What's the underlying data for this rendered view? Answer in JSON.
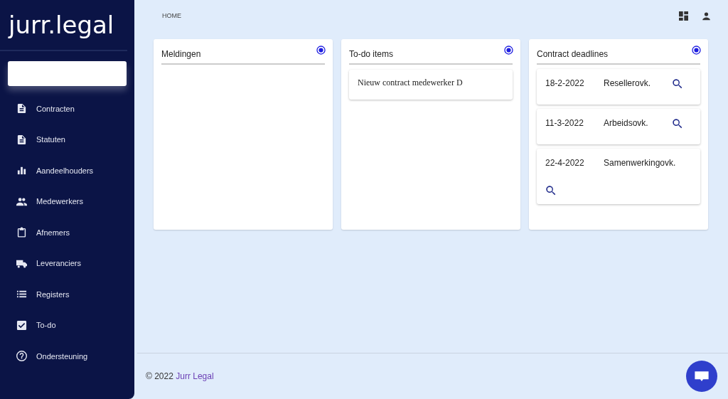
{
  "sidebar": {
    "logo": "jurr.legal",
    "items": [
      {
        "label": "Contracten"
      },
      {
        "label": "Statuten"
      },
      {
        "label": "Aandeelhouders"
      },
      {
        "label": "Medewerkers"
      },
      {
        "label": "Afnemers"
      },
      {
        "label": "Leveranciers"
      },
      {
        "label": "Registers"
      },
      {
        "label": "To-do"
      },
      {
        "label": "Ondersteuning"
      }
    ]
  },
  "breadcrumb": "HOME",
  "cards": [
    {
      "title": "Meldingen",
      "radio_checked": true,
      "kind": "empty"
    },
    {
      "title": "To-do items",
      "radio_checked": true,
      "kind": "todo",
      "items": [
        "Nieuw contract medewerker D"
      ]
    },
    {
      "title": "Contract deadlines",
      "radio_checked": true,
      "kind": "deadlines",
      "items": [
        {
          "date": "18-2-2022",
          "name": "Resellerovk."
        },
        {
          "date": "11-3-2022",
          "name": "Arbeidsovk."
        },
        {
          "date": "22-4-2022",
          "name": "Samenwerkingovk."
        }
      ]
    }
  ],
  "footer": {
    "copyright": "© 2022",
    "link": "Jurr Legal"
  }
}
